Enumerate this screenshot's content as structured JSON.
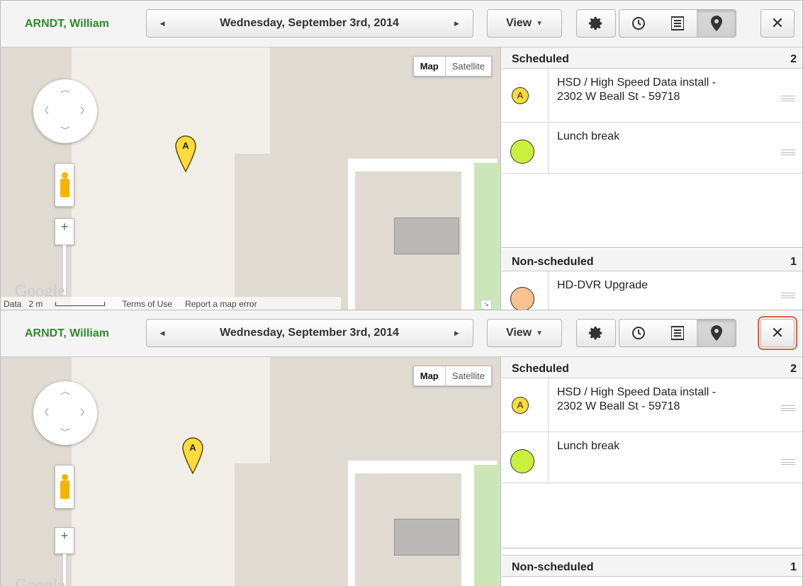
{
  "toolbar": {
    "tech_name": "ARNDT, William",
    "date": "Wednesday, September 3rd, 2014",
    "view_label": "View",
    "tech_color": "#2e8b2e"
  },
  "icons": {
    "prev": "chevron-left-icon",
    "next": "chevron-right-icon",
    "settings": "gear-icon",
    "time": "clock-icon",
    "list": "list-icon",
    "map": "map-pin-icon",
    "close": "close-icon"
  },
  "map": {
    "type_map": "Map",
    "type_satellite": "Satellite",
    "marker_label": "A",
    "logo": "Google",
    "attrib_data": "Data",
    "scale": "2 m",
    "terms": "Terms of Use",
    "report": "Report a map error"
  },
  "scheduled": {
    "title": "Scheduled",
    "count": "2",
    "items": [
      {
        "line1": "HSD / High Speed Data install -",
        "line2": "2302 W Beall St - 59718",
        "badge": "A",
        "color": "#fddb3a"
      },
      {
        "line1": "Lunch break",
        "line2": "",
        "badge": "",
        "color": "#c8f03c"
      }
    ]
  },
  "nonscheduled": {
    "title": "Non-scheduled",
    "count": "1",
    "items": [
      {
        "line1": "HD-DVR Upgrade",
        "color": "#f9c090"
      }
    ]
  },
  "highlight": {
    "color": "#e0604a",
    "target": "close-button-second-panel"
  }
}
